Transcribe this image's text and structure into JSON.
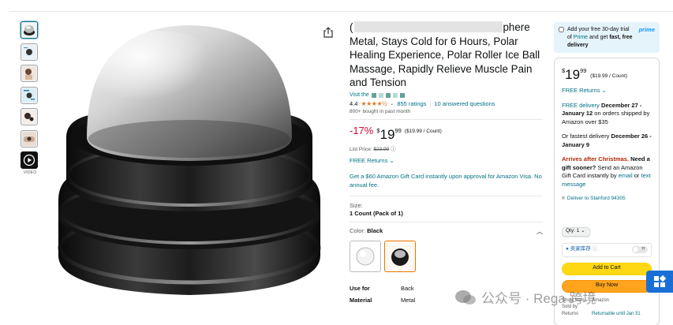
{
  "thumbnails": [
    {
      "name": "thumb-product-ball",
      "selected": true
    },
    {
      "name": "thumb-product-detail",
      "selected": false
    },
    {
      "name": "thumb-lifestyle-1",
      "selected": false
    },
    {
      "name": "thumb-infographic",
      "selected": false
    },
    {
      "name": "thumb-lifestyle-2",
      "selected": false
    },
    {
      "name": "thumb-lifestyle-3",
      "selected": false
    }
  ],
  "video_label": "VIDEO",
  "product": {
    "title_start": "(",
    "title_line1_end": "phere",
    "title_rest": "Metal, Stays Cold for 6 Hours, Polar Healing Experience, Polar Roller Ice Ball Massage, Rapidly Relieve Muscle Pain and Tension",
    "visit": "Visit the",
    "rating_value": "4.4",
    "stars": "★★★★½",
    "ratings_count": "855 ratings",
    "answered": "10 answered questions",
    "bought": "800+ bought in past month",
    "discount": "-17%",
    "price_dollar": "$",
    "price_whole": "19",
    "price_cents": "99",
    "price_per_count": "($19.99 / Count)",
    "list_price_label": "List Price:",
    "list_price": "$23.99",
    "returns": "FREE Returns",
    "gift_offer": "Get a $60 Amazon Gift Card instantly upon approval for Amazon Visa. No annual fee.",
    "size_label": "Size:",
    "size_value": "1 Count (Pack of 1)",
    "color_label": "Color:",
    "color_value": "Black",
    "specs": [
      {
        "key": "Use for",
        "value": "Back"
      },
      {
        "key": "Material",
        "value": "Metal"
      }
    ]
  },
  "prime": {
    "text_1": "Add your free 30-day trial of ",
    "text_link": "Prime",
    "text_2": " and get ",
    "text_bold": "fast, free delivery",
    "logo": "prime"
  },
  "buybox": {
    "price_dollar": "$",
    "price_whole": "19",
    "price_cents": "99",
    "price_per_count": "($19.99 / Count)",
    "returns": "FREE Returns",
    "delivery_link": "FREE delivery",
    "delivery_dates": "December 27 - January 12",
    "delivery_rest": "on orders shipped by Amazon over $35",
    "fastest_prefix": "Or fastest delivery",
    "fastest_dates": "December 26 - January 9",
    "arrives_after": "Arrives after Christmas.",
    "need_gift": "Need a gift sooner?",
    "gift_text": "Send an Amazon Gift Card instantly by",
    "email": "email",
    "or": "or",
    "text_message": "text message",
    "deliver_to": "Deliver to Stanford 94305",
    "qty": "Qty: 1",
    "stock_label": "卖家库存",
    "stock_toggle": "开",
    "add_to_cart": "Add to Cart",
    "buy_now": "Buy Now",
    "ships_from_label": "Ships from",
    "ships_from_value": "Amazon",
    "sold_by_label": "Sold by",
    "sold_by_value": "",
    "returns_label": "Returns",
    "returns_value": "Returnable until Jan 31"
  },
  "watermark": {
    "brand": "公众号 · Rega 跨境"
  },
  "colors": {
    "link": "#007185",
    "discount": "#cc0c39",
    "cart": "#ffd814",
    "buy": "#ffa41c",
    "prime_bg": "#e5f3fb"
  }
}
